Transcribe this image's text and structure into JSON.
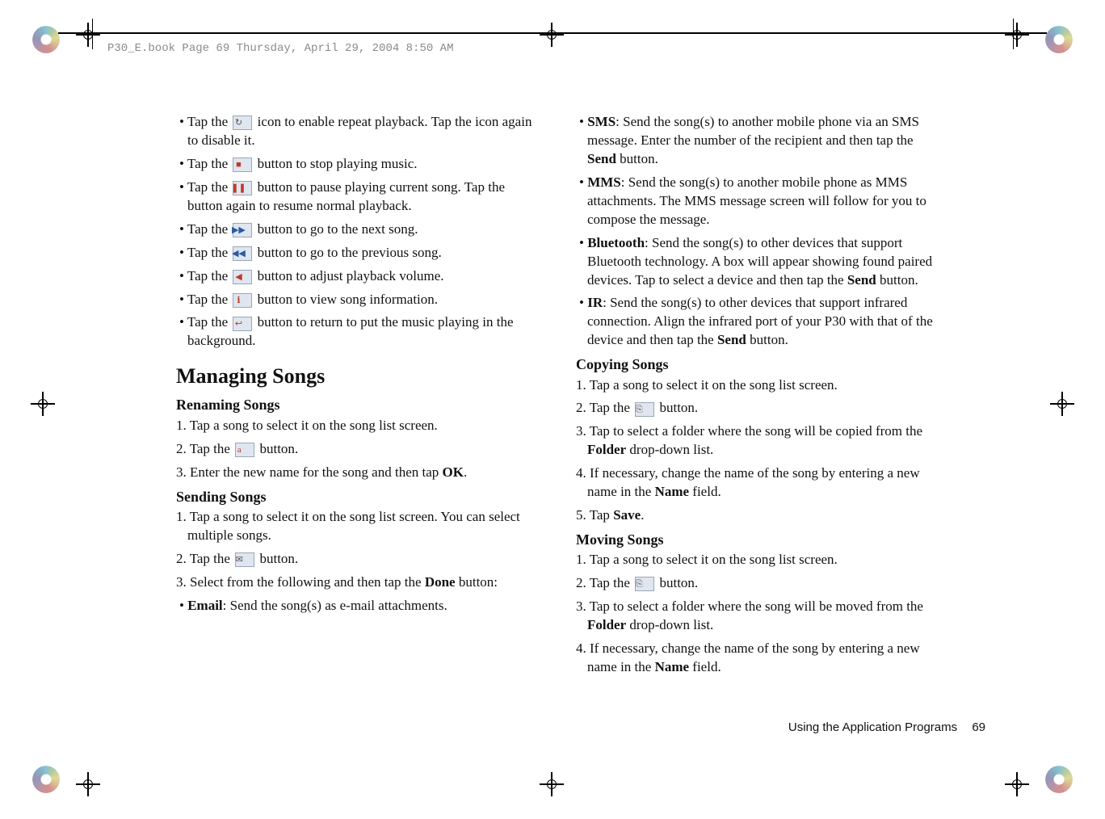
{
  "meta": {
    "headerText": "P30_E.book  Page 69  Thursday, April 29, 2004  8:50 AM"
  },
  "left": {
    "b1a": "Tap the ",
    "b1b": " icon to enable repeat playback. Tap the icon again to disable it.",
    "b2a": "Tap the ",
    "b2b": " button to stop playing music.",
    "b3a": "Tap the ",
    "b3b": " button to pause playing current song. Tap the button again to resume normal playback.",
    "b4a": "Tap the ",
    "b4b": " button to go to the next song.",
    "b5a": "Tap the ",
    "b5b": " button to go to the previous song.",
    "b6a": "Tap the ",
    "b6b": " button to adjust playback volume.",
    "b7a": "Tap the ",
    "b7b": " button to view song information.",
    "b8a": "Tap the ",
    "b8b": " button to return to put the music playing in the background.",
    "h2": "Managing Songs",
    "h3a": "Renaming Songs",
    "r1": "1. Tap a song to select it on the song list screen.",
    "r2a": "2. Tap the ",
    "r2b": " button.",
    "r3a": "3. Enter the new name for the song and then tap ",
    "r3b": "OK",
    "r3c": ".",
    "h3b": "Sending Songs",
    "s1": "1. Tap a song to select it on the song list screen. You can select multiple songs.",
    "s2a": "2. Tap the ",
    "s2b": " button.",
    "s3a": "3. Select from the following and then tap the ",
    "s3b": "Done",
    "s3c": " button:",
    "s4a": "Email",
    "s4b": ": Send the song(s) as e-mail attachments."
  },
  "right": {
    "sms_a": "SMS",
    "sms_b": ": Send the song(s) to another mobile phone via an SMS message. Enter the number of the recipient and then tap the ",
    "sms_c": "Send",
    "sms_d": " button.",
    "mms_a": "MMS",
    "mms_b": ": Send the song(s) to another mobile phone as MMS attachments. The MMS message screen will follow for you to compose the message.",
    "bt_a": "Bluetooth",
    "bt_b": ": Send the song(s) to other devices that support Bluetooth technology. A box will appear showing found paired devices. Tap to select a device and then tap the ",
    "bt_c": "Send",
    "bt_d": " button.",
    "ir_a": "IR",
    "ir_b": ": Send the song(s) to other devices that support infrared connection. Align the infrared port of your P30 with that of the device and then tap the ",
    "ir_c": "Send",
    "ir_d": " button.",
    "h3c": "Copying Songs",
    "c1": "1. Tap a song to select it on the song list screen.",
    "c2a": "2. Tap the ",
    "c2b": " button.",
    "c3a": "3. Tap to select a folder where the song will be copied from the ",
    "c3b": "Folder",
    "c3c": " drop-down list.",
    "c4a": "4. If necessary, change the name of the song by entering a new name in the ",
    "c4b": "Name",
    "c4c": " field.",
    "c5a": "5. Tap ",
    "c5b": "Save",
    "c5c": ".",
    "h3d": "Moving Songs",
    "m1": "1. Tap a song to select it on the song list screen.",
    "m2a": "2. Tap the ",
    "m2b": " button.",
    "m3a": "3. Tap to select a folder where the song will be moved from the ",
    "m3b": "Folder",
    "m3c": " drop-down list.",
    "m4a": "4. If necessary, change the name of the song by entering a new name in the ",
    "m4b": "Name",
    "m4c": " field."
  },
  "footer": {
    "title": "Using the Application Programs",
    "page": "69"
  },
  "icons": {
    "repeat": "↻",
    "stop": "■",
    "pause": "❚❚",
    "next": "▶▶",
    "prev": "◀◀",
    "volume": "◀",
    "info": "ℹ",
    "return": "↩",
    "rename": "a",
    "send": "✉",
    "copy": "⎘",
    "move": "⎘"
  }
}
